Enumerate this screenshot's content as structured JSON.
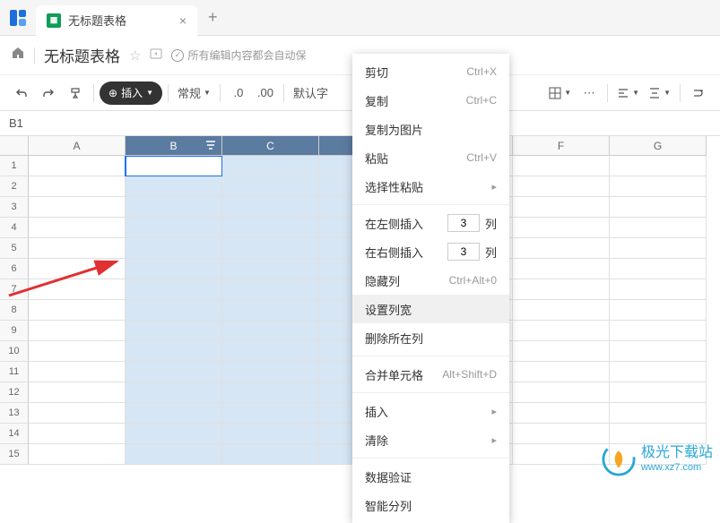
{
  "tab": {
    "title": "无标题表格"
  },
  "doc": {
    "title": "无标题表格",
    "save_status": "所有编辑内容都会自动保"
  },
  "toolbar": {
    "insert_label": "插入",
    "format_label": "常规",
    "decimals": ".0",
    "decimals2": ".00",
    "font_label": "默认字"
  },
  "cell_ref": "B1",
  "columns": [
    "A",
    "B",
    "C",
    "",
    "",
    "F",
    "G"
  ],
  "selected_cols": [
    1,
    2,
    3
  ],
  "active_cell": {
    "row": 0,
    "col": 1
  },
  "row_count": 15,
  "context_menu": {
    "cut": {
      "label": "剪切",
      "shortcut": "Ctrl+X"
    },
    "copy": {
      "label": "复制",
      "shortcut": "Ctrl+C"
    },
    "copy_as_image": {
      "label": "复制为图片"
    },
    "paste": {
      "label": "粘贴",
      "shortcut": "Ctrl+V"
    },
    "paste_special": {
      "label": "选择性粘贴"
    },
    "insert_left": {
      "label": "在左侧插入",
      "value": "3",
      "unit": "列"
    },
    "insert_right": {
      "label": "在右侧插入",
      "value": "3",
      "unit": "列"
    },
    "hide_col": {
      "label": "隐藏列",
      "shortcut": "Ctrl+Alt+0"
    },
    "set_col_width": {
      "label": "设置列宽"
    },
    "delete_col": {
      "label": "删除所在列"
    },
    "merge": {
      "label": "合并单元格",
      "shortcut": "Alt+Shift+D"
    },
    "insert": {
      "label": "插入"
    },
    "clear": {
      "label": "清除"
    },
    "data_validation": {
      "label": "数据验证"
    },
    "smart_split": {
      "label": "智能分列"
    }
  },
  "watermark": {
    "name": "极光下载站",
    "url": "www.xz7.com"
  }
}
